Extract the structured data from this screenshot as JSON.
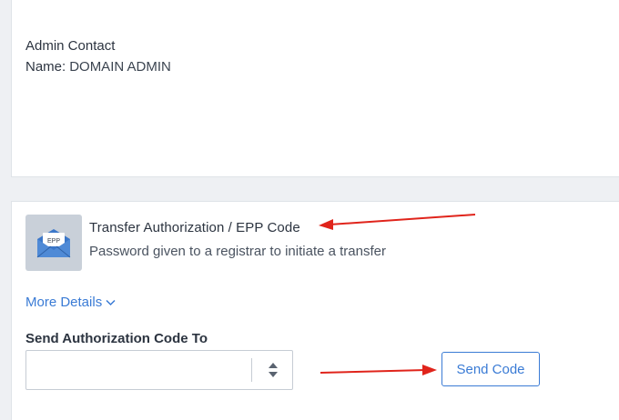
{
  "admin_contact": {
    "title": "Admin Contact",
    "name_label": "Name:",
    "name_value": "DOMAIN ADMIN"
  },
  "transfer": {
    "icon": "envelope-epp-icon",
    "icon_text": "EPP",
    "title": "Transfer Authorization / EPP Code",
    "subtitle": "Password given to a registrar to initiate a transfer",
    "more_details": "More Details",
    "send_label": "Send Authorization Code To",
    "select_value": "",
    "send_button": "Send Code"
  },
  "colors": {
    "accent": "#3a7bd5",
    "annotation_arrow": "#e0241b",
    "icon_tile": "#c9d0d9",
    "envelope": "#3b77c9"
  }
}
